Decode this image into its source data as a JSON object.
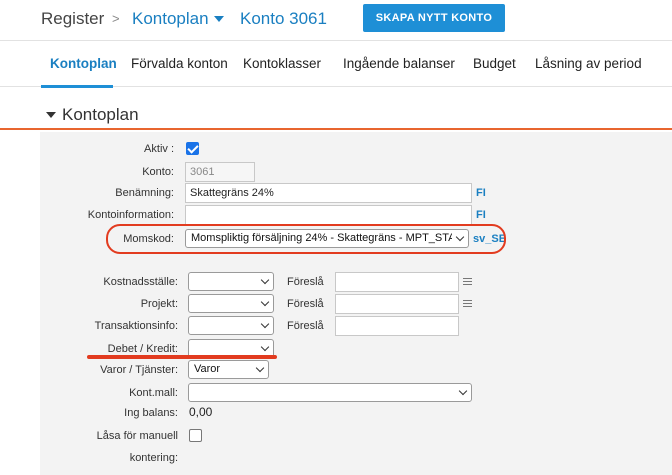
{
  "breadcrumb": {
    "register": "Register",
    "separator": ">",
    "kontoplan": "Kontoplan",
    "konto": "Konto 3061"
  },
  "header": {
    "create_button": "SKAPA NYTT KONTO"
  },
  "tabs": [
    {
      "label": "Kontoplan",
      "active": true
    },
    {
      "label": "Förvalda konton"
    },
    {
      "label": "Kontoklasser"
    },
    {
      "label": "Ingående balanser"
    },
    {
      "label": "Budget"
    },
    {
      "label": "Låsning av period"
    }
  ],
  "section": {
    "title": "Kontoplan"
  },
  "form": {
    "aktiv": {
      "label": "Aktiv :",
      "checked": true
    },
    "konto": {
      "label": "Konto:",
      "value": "3061"
    },
    "benamning": {
      "label": "Benämning:",
      "value": "Skattegräns 24%",
      "link": "FI"
    },
    "kontoinformation": {
      "label": "Kontoinformation:",
      "value": "",
      "link": "FI"
    },
    "momskod": {
      "label": "Momskod:",
      "value": "Momspliktig försäljning 24% - Skattegräns - MPT_STA",
      "link": "sv_SE"
    },
    "kostnadsstalle": {
      "label": "Kostnadsställe:",
      "value": "",
      "suggest": "Föreslå"
    },
    "projekt": {
      "label": "Projekt:",
      "value": "",
      "suggest": "Föreslå"
    },
    "transaktionsinfo": {
      "label": "Transaktionsinfo:",
      "value": "",
      "suggest": "Föreslå"
    },
    "debet_kredit": {
      "label": "Debet / Kredit:",
      "value": ""
    },
    "varor_tjanster": {
      "label": "Varor / Tjänster:",
      "value": "Varor"
    },
    "kont_mall": {
      "label": "Kont.mall:",
      "value": ""
    },
    "ing_balans": {
      "label": "Ing balans:",
      "value": "0,00"
    },
    "lasa": {
      "label_line1": "Låsa för manuell",
      "label_line2": "kontering:",
      "checked": false
    }
  },
  "colors": {
    "accent": "#1e8fd6",
    "link": "#1a7fc1",
    "section_rule": "#e8652f",
    "highlight": "#e23b1f"
  }
}
